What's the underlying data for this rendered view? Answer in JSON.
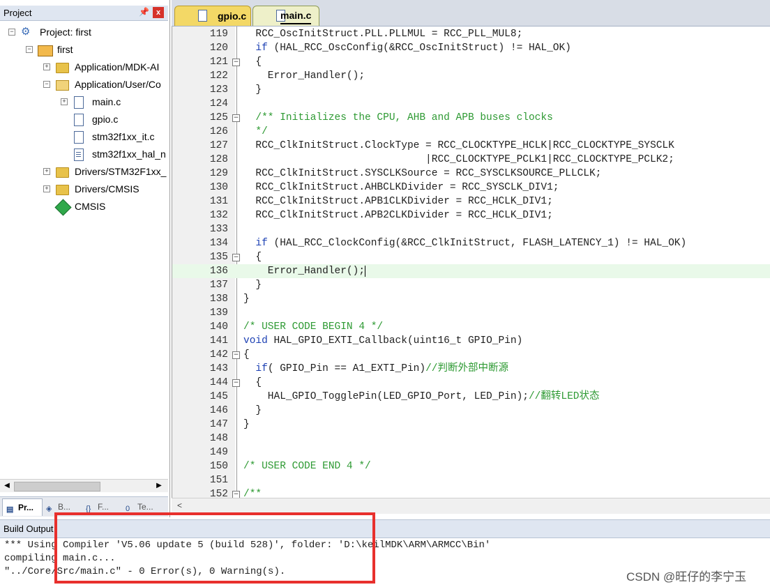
{
  "project_panel": {
    "title": "Project",
    "pin_icon": "pin-icon",
    "close_label": "x",
    "tree": [
      {
        "label": "Project: first",
        "icon": "project-icon",
        "toggle": "−"
      },
      {
        "label": "first",
        "icon": "target-icon",
        "toggle": "−"
      },
      {
        "label": "Application/MDK-AI",
        "icon": "folder-icon",
        "toggle": "+"
      },
      {
        "label": "Application/User/Co",
        "icon": "folder-open-icon",
        "toggle": "−"
      },
      {
        "label": "main.c",
        "icon": "file-icon",
        "toggle": "+"
      },
      {
        "label": "gpio.c",
        "icon": "file-icon",
        "toggle": ""
      },
      {
        "label": "stm32f1xx_it.c",
        "icon": "file-icon",
        "toggle": ""
      },
      {
        "label": "stm32f1xx_hal_n",
        "icon": "file-icon",
        "toggle": ""
      },
      {
        "label": "Drivers/STM32F1xx_",
        "icon": "folder-icon",
        "toggle": "+"
      },
      {
        "label": "Drivers/CMSIS",
        "icon": "folder-icon",
        "toggle": "+"
      },
      {
        "label": "CMSIS",
        "icon": "cmsis-icon",
        "toggle": ""
      }
    ],
    "tabs": [
      {
        "label": "Pr...",
        "icon": "project-tab-icon"
      },
      {
        "label": "B...",
        "icon": "books-tab-icon"
      },
      {
        "label": "F...",
        "icon": "functions-tab-icon"
      },
      {
        "label": "Te...",
        "icon": "templates-tab-icon"
      }
    ]
  },
  "editor": {
    "tabs": [
      {
        "label": "gpio.c",
        "active": false
      },
      {
        "label": "main.c",
        "active": true
      }
    ],
    "lines": [
      {
        "num": "119",
        "fold": "",
        "code": [
          {
            "t": "  RCC_OscInitStruct.PLL.PLLMUL = RCC_PLL_MUL8;",
            "c": ""
          }
        ]
      },
      {
        "num": "120",
        "fold": "",
        "code": [
          {
            "t": "  ",
            "c": ""
          },
          {
            "t": "if",
            "c": "kw"
          },
          {
            "t": " (HAL_RCC_OscConfig(&RCC_OscInitStruct) != HAL_OK)",
            "c": ""
          }
        ]
      },
      {
        "num": "121",
        "fold": "−",
        "code": [
          {
            "t": "  {",
            "c": ""
          }
        ]
      },
      {
        "num": "122",
        "fold": "",
        "code": [
          {
            "t": "    Error_Handler();",
            "c": ""
          }
        ]
      },
      {
        "num": "123",
        "fold": "",
        "code": [
          {
            "t": "  }",
            "c": ""
          }
        ]
      },
      {
        "num": "124",
        "fold": "",
        "code": [
          {
            "t": "",
            "c": ""
          }
        ]
      },
      {
        "num": "125",
        "fold": "−",
        "code": [
          {
            "t": "  ",
            "c": ""
          },
          {
            "t": "/** Initializes the CPU, AHB and APB buses clocks",
            "c": "cm"
          }
        ]
      },
      {
        "num": "126",
        "fold": "",
        "code": [
          {
            "t": "  ",
            "c": ""
          },
          {
            "t": "*/",
            "c": "cm"
          }
        ]
      },
      {
        "num": "127",
        "fold": "",
        "code": [
          {
            "t": "  RCC_ClkInitStruct.ClockType = RCC_CLOCKTYPE_HCLK|RCC_CLOCKTYPE_SYSCLK",
            "c": ""
          }
        ]
      },
      {
        "num": "128",
        "fold": "",
        "code": [
          {
            "t": "                              |RCC_CLOCKTYPE_PCLK1|RCC_CLOCKTYPE_PCLK2;",
            "c": ""
          }
        ]
      },
      {
        "num": "129",
        "fold": "",
        "code": [
          {
            "t": "  RCC_ClkInitStruct.SYSCLKSource = RCC_SYSCLKSOURCE_PLLCLK;",
            "c": ""
          }
        ]
      },
      {
        "num": "130",
        "fold": "",
        "code": [
          {
            "t": "  RCC_ClkInitStruct.AHBCLKDivider = RCC_SYSCLK_DIV1;",
            "c": ""
          }
        ]
      },
      {
        "num": "131",
        "fold": "",
        "code": [
          {
            "t": "  RCC_ClkInitStruct.APB1CLKDivider = RCC_HCLK_DIV1;",
            "c": ""
          }
        ]
      },
      {
        "num": "132",
        "fold": "",
        "code": [
          {
            "t": "  RCC_ClkInitStruct.APB2CLKDivider = RCC_HCLK_DIV1;",
            "c": ""
          }
        ]
      },
      {
        "num": "133",
        "fold": "",
        "code": [
          {
            "t": "",
            "c": ""
          }
        ]
      },
      {
        "num": "134",
        "fold": "",
        "code": [
          {
            "t": "  ",
            "c": ""
          },
          {
            "t": "if",
            "c": "kw"
          },
          {
            "t": " (HAL_RCC_ClockConfig(&RCC_ClkInitStruct, FLASH_LATENCY_1) != HAL_OK)",
            "c": ""
          }
        ]
      },
      {
        "num": "135",
        "fold": "−",
        "code": [
          {
            "t": "  {",
            "c": ""
          }
        ]
      },
      {
        "num": "136",
        "fold": "",
        "code": [
          {
            "t": "    Error_Handler();",
            "c": ""
          }
        ],
        "current": true
      },
      {
        "num": "137",
        "fold": "",
        "code": [
          {
            "t": "  }",
            "c": ""
          }
        ]
      },
      {
        "num": "138",
        "fold": "",
        "code": [
          {
            "t": "}",
            "c": ""
          }
        ]
      },
      {
        "num": "139",
        "fold": "",
        "code": [
          {
            "t": "",
            "c": ""
          }
        ]
      },
      {
        "num": "140",
        "fold": "",
        "code": [
          {
            "t": "/* USER CODE BEGIN 4 */",
            "c": "cm"
          }
        ]
      },
      {
        "num": "141",
        "fold": "",
        "code": [
          {
            "t": "void",
            "c": "kw"
          },
          {
            "t": " HAL_GPIO_EXTI_Callback(uint16_t GPIO_Pin)",
            "c": ""
          }
        ]
      },
      {
        "num": "142",
        "fold": "−",
        "code": [
          {
            "t": "{",
            "c": ""
          }
        ]
      },
      {
        "num": "143",
        "fold": "",
        "code": [
          {
            "t": "  ",
            "c": ""
          },
          {
            "t": "if",
            "c": "kw"
          },
          {
            "t": "( GPIO_Pin == A1_EXTI_Pin)",
            "c": ""
          },
          {
            "t": "//判断外部中断源",
            "c": "cm"
          }
        ]
      },
      {
        "num": "144",
        "fold": "−",
        "code": [
          {
            "t": "  {",
            "c": ""
          }
        ]
      },
      {
        "num": "145",
        "fold": "",
        "code": [
          {
            "t": "    HAL_GPIO_TogglePin(LED_GPIO_Port, LED_Pin);",
            "c": ""
          },
          {
            "t": "//翻转LED状态",
            "c": "cm"
          }
        ]
      },
      {
        "num": "146",
        "fold": "",
        "code": [
          {
            "t": "  }",
            "c": ""
          }
        ]
      },
      {
        "num": "147",
        "fold": "",
        "code": [
          {
            "t": "}",
            "c": ""
          }
        ]
      },
      {
        "num": "148",
        "fold": "",
        "code": [
          {
            "t": "",
            "c": ""
          }
        ]
      },
      {
        "num": "149",
        "fold": "",
        "code": [
          {
            "t": "",
            "c": ""
          }
        ]
      },
      {
        "num": "150",
        "fold": "",
        "code": [
          {
            "t": "/* USER CODE END 4 */",
            "c": "cm"
          }
        ]
      },
      {
        "num": "151",
        "fold": "",
        "code": [
          {
            "t": "",
            "c": ""
          }
        ]
      },
      {
        "num": "152",
        "fold": "−",
        "code": [
          {
            "t": "/**",
            "c": "cm"
          }
        ]
      }
    ]
  },
  "build_output": {
    "title": "Build Output",
    "lines": [
      "*** Using Compiler 'V5.06 update 5 (build 528)', folder: 'D:\\keilMDK\\ARM\\ARMCC\\Bin'",
      "compiling main.c...",
      "\"../Core/Src/main.c\" - 0 Error(s), 0 Warning(s)."
    ]
  },
  "watermark": "CSDN @旺仔的李宁玉",
  "colors": {
    "keyword": "#1b3fb3",
    "comment": "#2e9a33",
    "highlight_box": "#e8302d"
  }
}
